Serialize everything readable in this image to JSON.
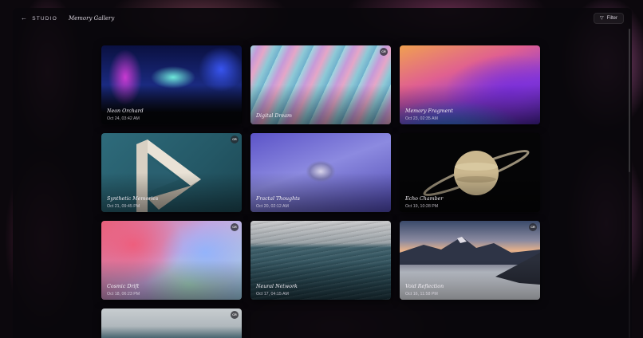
{
  "header": {
    "back_label": "STUDIO",
    "title": "Memory Gallery",
    "filter_label": "Filter"
  },
  "cards": [
    {
      "name": "Neon Orchard",
      "date": "Oct 24, 03:42 AM",
      "badge": ""
    },
    {
      "name": "Digital Dream",
      "date": "",
      "badge": "CR"
    },
    {
      "name": "Memory Fragment",
      "date": "Oct 23, 02:35 AM",
      "badge": ""
    },
    {
      "name": "Synthetic Memories",
      "date": "Oct 21, 09:45 PM",
      "badge": "CR"
    },
    {
      "name": "Fractal Thoughts",
      "date": "Oct 20, 02:12 AM",
      "badge": ""
    },
    {
      "name": "Echo Chamber",
      "date": "Oct 19, 10:28 PM",
      "badge": ""
    },
    {
      "name": "Cosmic Drift",
      "date": "Oct 18, 06:23 PM",
      "badge": "CR"
    },
    {
      "name": "Neural Network",
      "date": "Oct 17, 04:15 AM",
      "badge": ""
    },
    {
      "name": "Void Reflection",
      "date": "Oct 16, 11:58 PM",
      "badge": "CR"
    },
    {
      "name": "",
      "date": "",
      "badge": "CR"
    }
  ]
}
